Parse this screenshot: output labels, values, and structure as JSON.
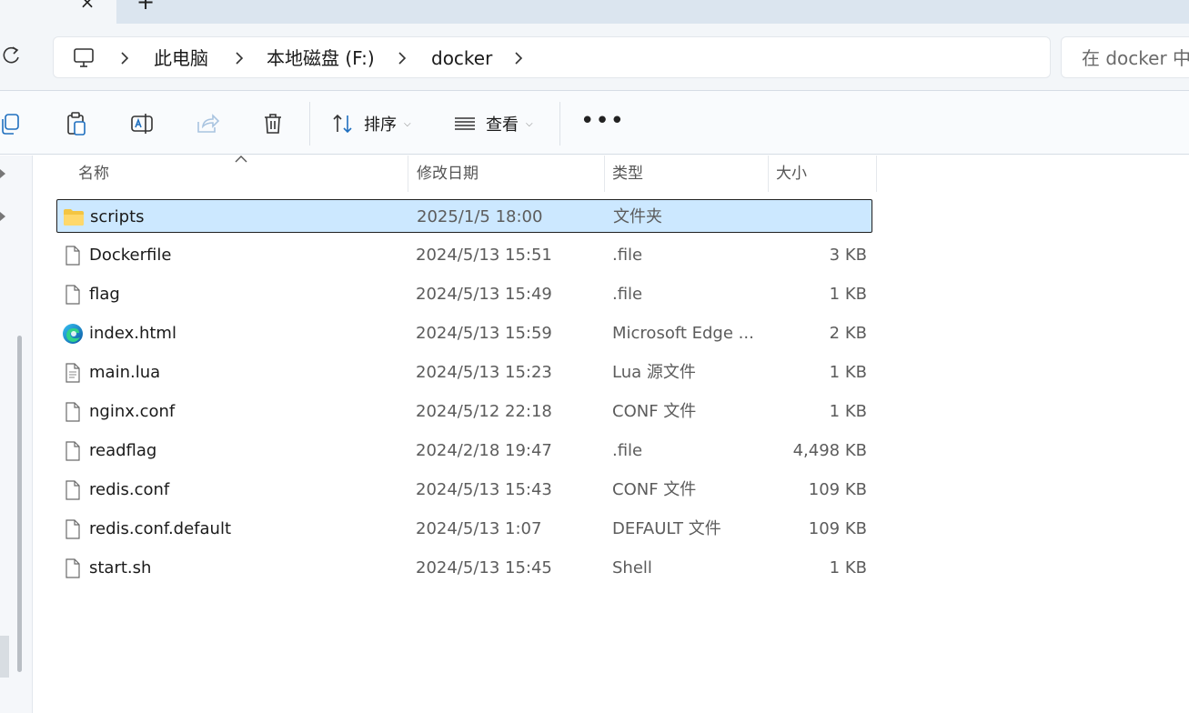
{
  "tab": {
    "close_glyph": "×",
    "new_tab_glyph": "+"
  },
  "breadcrumbs": [
    "此电脑",
    "本地磁盘 (F:)",
    "docker"
  ],
  "search": {
    "placeholder": "在 docker 中搜索"
  },
  "toolbar": {
    "sort_label": "排序",
    "view_label": "查看",
    "more_glyph": "•••"
  },
  "columns": {
    "name": "名称",
    "date": "修改日期",
    "type": "类型",
    "size": "大小"
  },
  "files": [
    {
      "name": "scripts",
      "date": "2025/1/5 18:00",
      "type": "文件夹",
      "size": "",
      "icon": "folder-icon",
      "selected": true
    },
    {
      "name": "Dockerfile",
      "date": "2024/5/13 15:51",
      "type": ".file",
      "size": "3 KB",
      "icon": "file-icon"
    },
    {
      "name": "flag",
      "date": "2024/5/13 15:49",
      "type": ".file",
      "size": "1 KB",
      "icon": "file-icon"
    },
    {
      "name": "index.html",
      "date": "2024/5/13 15:59",
      "type": "Microsoft Edge ...",
      "size": "2 KB",
      "icon": "edge-icon"
    },
    {
      "name": "main.lua",
      "date": "2024/5/13 15:23",
      "type": "Lua 源文件",
      "size": "1 KB",
      "icon": "text-file-icon"
    },
    {
      "name": "nginx.conf",
      "date": "2024/5/12 22:18",
      "type": "CONF 文件",
      "size": "1 KB",
      "icon": "file-icon"
    },
    {
      "name": "readflag",
      "date": "2024/2/18 19:47",
      "type": ".file",
      "size": "4,498 KB",
      "icon": "file-icon"
    },
    {
      "name": "redis.conf",
      "date": "2024/5/13 15:43",
      "type": "CONF 文件",
      "size": "109 KB",
      "icon": "file-icon"
    },
    {
      "name": "redis.conf.default",
      "date": "2024/5/13 1:07",
      "type": "DEFAULT 文件",
      "size": "109 KB",
      "icon": "file-icon"
    },
    {
      "name": "start.sh",
      "date": "2024/5/13 15:45",
      "type": "Shell",
      "size": "1 KB",
      "icon": "file-icon"
    }
  ],
  "colors": {
    "selection": "#cce8ff",
    "folder": "#f4c542"
  }
}
